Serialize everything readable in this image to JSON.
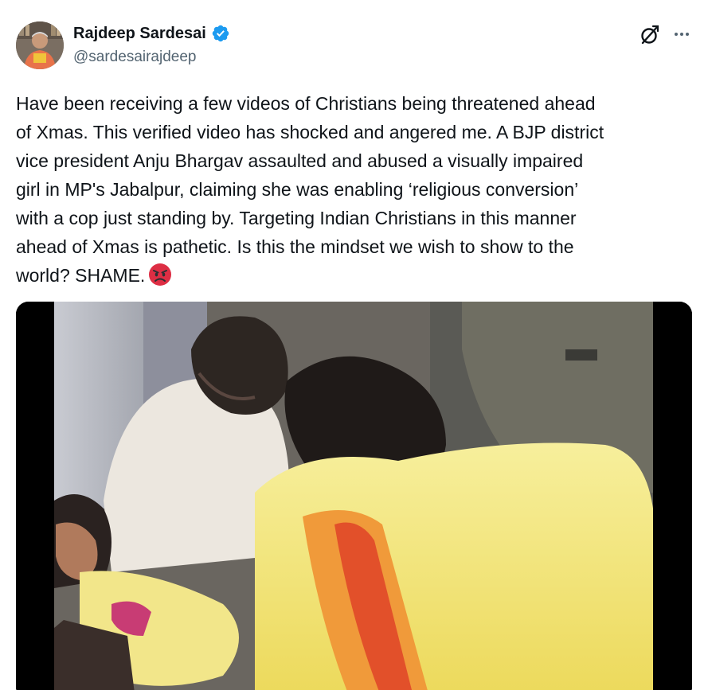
{
  "author": {
    "display_name": "Rajdeep Sardesai",
    "handle": "@sardesairajdeep",
    "verified": true,
    "avatar_icon": "avatar-photo"
  },
  "actions": {
    "grok_icon": "grok-icon",
    "more_icon": "more-options-icon"
  },
  "tweet": {
    "text": "Have been receiving a few videos of Christians being threatened ahead\nof Xmas. This verified video has shocked and angered me. A BJP district\nvice president Anju Bhargav assaulted and abused a visually impaired\ngirl in MP's Jabalpur, claiming she was enabling ‘religious conversion’\nwith a cop just standing by. Targeting Indian Christians in this manner\nahead of Xmas is pathetic. Is this the mindset we wish to show to the\nworld? SHAME.",
    "emoji": "angry-face-emoji"
  },
  "media": {
    "type": "video",
    "icon": "video-thumbnail"
  },
  "colors": {
    "verified_blue": "#1d9bf0",
    "text_primary": "#0f1419",
    "text_secondary": "#536471"
  }
}
